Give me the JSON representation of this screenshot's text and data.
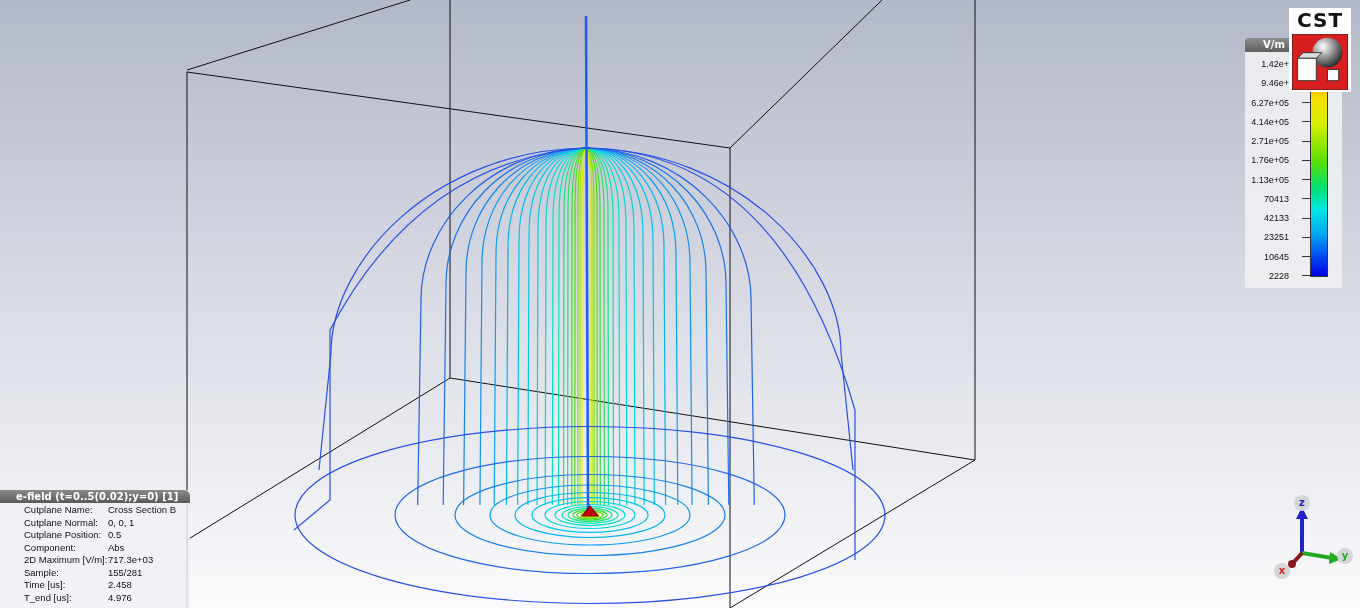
{
  "logo": {
    "text": "CST"
  },
  "legend": {
    "unit": "V/m",
    "ticks": [
      "1.42e+",
      "9.46e+",
      "6.27e+05",
      "4.14e+05",
      "2.71e+05",
      "1.76e+05",
      "1.13e+05",
      "70413",
      "42133",
      "23251",
      "10645",
      "2228"
    ]
  },
  "info": {
    "title": "e-field (t=0..5(0.02);y=0) [1]",
    "rows": [
      {
        "label": "Cutplane Name:",
        "value": "Cross Section B"
      },
      {
        "label": "Cutplane Normal:",
        "value": "0, 0, 1"
      },
      {
        "label": "Cutplane Position:",
        "value": "0.5"
      },
      {
        "label": "Component:",
        "value": "Abs"
      },
      {
        "label": "2D Maximum [V/m]:",
        "value": "717.3e+03"
      },
      {
        "label": "Sample:",
        "value": "155/281"
      },
      {
        "label": "Time [us]:",
        "value": "2.458"
      },
      {
        "label": "T_end [us]:",
        "value": "4.976"
      }
    ]
  },
  "axes": [
    {
      "kind": "z",
      "label": "z"
    },
    {
      "kind": "y",
      "label": "y"
    },
    {
      "kind": "x",
      "label": "x"
    }
  ]
}
